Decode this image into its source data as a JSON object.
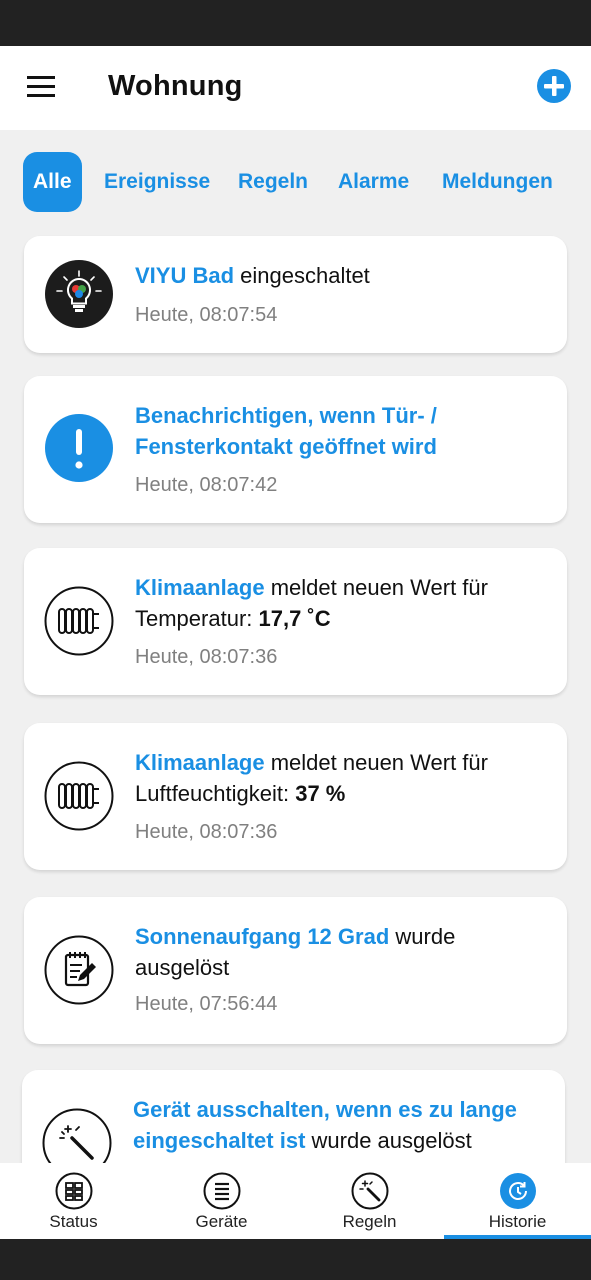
{
  "header": {
    "title": "Wohnung"
  },
  "tabs": [
    {
      "label": "Alle",
      "active": true
    },
    {
      "label": "Ereignisse"
    },
    {
      "label": "Regeln"
    },
    {
      "label": "Alarme"
    },
    {
      "label": "Meldungen"
    }
  ],
  "events": [
    {
      "icon": "color-bulb-icon",
      "highlight": "VIYU Bad",
      "text": " eingeschaltet",
      "time": "Heute, 08:07:54"
    },
    {
      "icon": "exclamation-icon",
      "highlight": "Benachrichtigen, wenn Tür- / Fensterkontakt geöffnet wird",
      "time": "Heute, 08:07:42"
    },
    {
      "icon": "radiator-icon",
      "highlight": "Klimaanlage",
      "text": " meldet neuen Wert für Temperatur: ",
      "value": "17,7 ˚C",
      "time": "Heute, 08:07:36"
    },
    {
      "icon": "radiator-icon",
      "highlight": "Klimaanlage",
      "text": " meldet neuen Wert für Luftfeuchtigkeit: ",
      "value": "37 %",
      "time": "Heute, 08:07:36"
    },
    {
      "icon": "notepad-icon",
      "highlight": "Sonnenaufgang 12 Grad",
      "text": " wurde ausgelöst",
      "time": "Heute, 07:56:44"
    },
    {
      "icon": "magic-wand-icon",
      "highlight": "Gerät ausschalten, wenn es zu lange eingeschaltet ist",
      "text": " wurde ausgelöst"
    }
  ],
  "bottom_nav": [
    {
      "label": "Status",
      "icon": "dashboard-icon"
    },
    {
      "label": "Geräte",
      "icon": "list-icon"
    },
    {
      "label": "Regeln",
      "icon": "magic-wand-icon"
    },
    {
      "label": "Historie",
      "icon": "history-icon",
      "active": true
    }
  ],
  "colors": {
    "accent": "#1a8fe3",
    "background": "#f0f0f0",
    "text": "#111111",
    "muted": "#808080"
  }
}
